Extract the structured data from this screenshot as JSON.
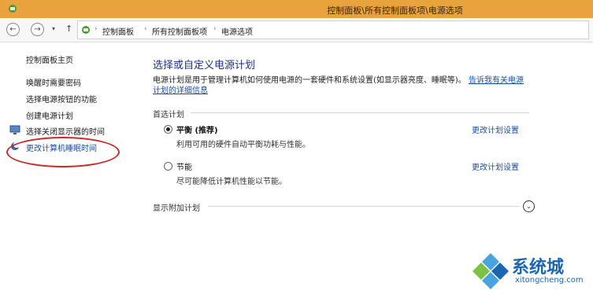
{
  "window": {
    "title": "控制面板\\所有控制面板项\\电源选项"
  },
  "nav": {
    "back": "←",
    "forward": "→",
    "dropdown": "▾",
    "up": "↑",
    "separator": "›",
    "breadcrumbs": [
      "控制面板",
      "所有控制面板项",
      "电源选项"
    ]
  },
  "sidebar": {
    "home": "控制面板主页",
    "items": [
      {
        "label": "唤醒时需要密码"
      },
      {
        "label": "选择电源按钮的功能"
      },
      {
        "label": "创建电源计划"
      },
      {
        "label": "选择关闭显示器的时间"
      },
      {
        "label": "更改计算机睡眠时间"
      }
    ]
  },
  "main": {
    "heading": "选择或自定义电源计划",
    "description": "电源计划是用于管理计算机如何使用电源的一套硬件和系统设置(如显示器亮度、睡眠等)。",
    "description_link": "告诉我有关电源计划的详细信息",
    "preferred_group": "首选计划",
    "plans": [
      {
        "name": "平衡 (推荐)",
        "desc": "利用可用的硬件自动平衡功耗与性能。",
        "change": "更改计划设置",
        "selected": true
      },
      {
        "name": "节能",
        "desc": "尽可能降低计算机性能以节能。",
        "change": "更改计划设置",
        "selected": false
      }
    ],
    "additional_group": "显示附加计划",
    "expand_icon": "⌄"
  },
  "watermark": {
    "brand": "系统城",
    "url": "xitongcheng.com"
  },
  "colors": {
    "titlebar": "#e8a33d",
    "link": "#1b4e9b",
    "heading": "#1e3287",
    "annotation": "#c72a2a"
  }
}
